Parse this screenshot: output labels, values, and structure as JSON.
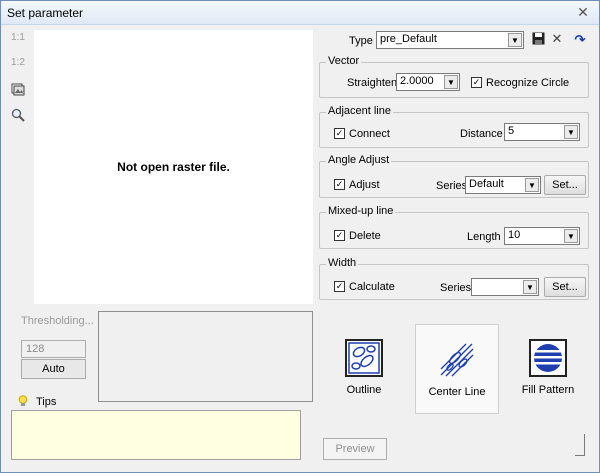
{
  "window": {
    "title": "Set parameter",
    "close_glyph": "✕"
  },
  "toolbar": {
    "zoom_1_1": "1:1",
    "zoom_1_2": "1:2",
    "image_icon": "image-icon",
    "magnifier_icon": "magnifier-icon"
  },
  "raster": {
    "message": "Not open raster file."
  },
  "threshold": {
    "label": "Thresholding...",
    "value": "128",
    "auto_label": "Auto"
  },
  "tips": {
    "label": "Tips",
    "text": ""
  },
  "type": {
    "label": "Type",
    "value": "pre_Default",
    "save_icon": "save-icon",
    "delete_icon": "delete-icon",
    "refresh_icon": "refresh-icon"
  },
  "vector": {
    "title": "Vector",
    "straighten_label": "Straighten",
    "straighten_value": "2.0000",
    "recognize_label": "Recognize Circle",
    "recognize_checked": true
  },
  "adjacent": {
    "title": "Adjacent line",
    "connect_label": "Connect",
    "connect_checked": true,
    "distance_label": "Distance",
    "distance_value": "5"
  },
  "angle": {
    "title": "Angle Adjust",
    "adjust_label": "Adjust",
    "adjust_checked": true,
    "series_label": "Series",
    "series_value": "Default",
    "set_label": "Set..."
  },
  "mixed": {
    "title": "Mixed-up line",
    "delete_label": "Delete",
    "delete_checked": true,
    "length_label": "Length",
    "length_value": "10"
  },
  "width": {
    "title": "Width",
    "calculate_label": "Calculate",
    "calculate_checked": true,
    "series_label": "Series",
    "series_value": "",
    "set_label": "Set..."
  },
  "modes": [
    {
      "label": "Outline",
      "selected": false
    },
    {
      "label": "Center Line",
      "selected": true
    },
    {
      "label": "Fill Pattern",
      "selected": false
    }
  ],
  "preview_label": "Preview",
  "colors": {
    "accent": "#1f3fb0",
    "tips_bg": "#ffffe1"
  }
}
